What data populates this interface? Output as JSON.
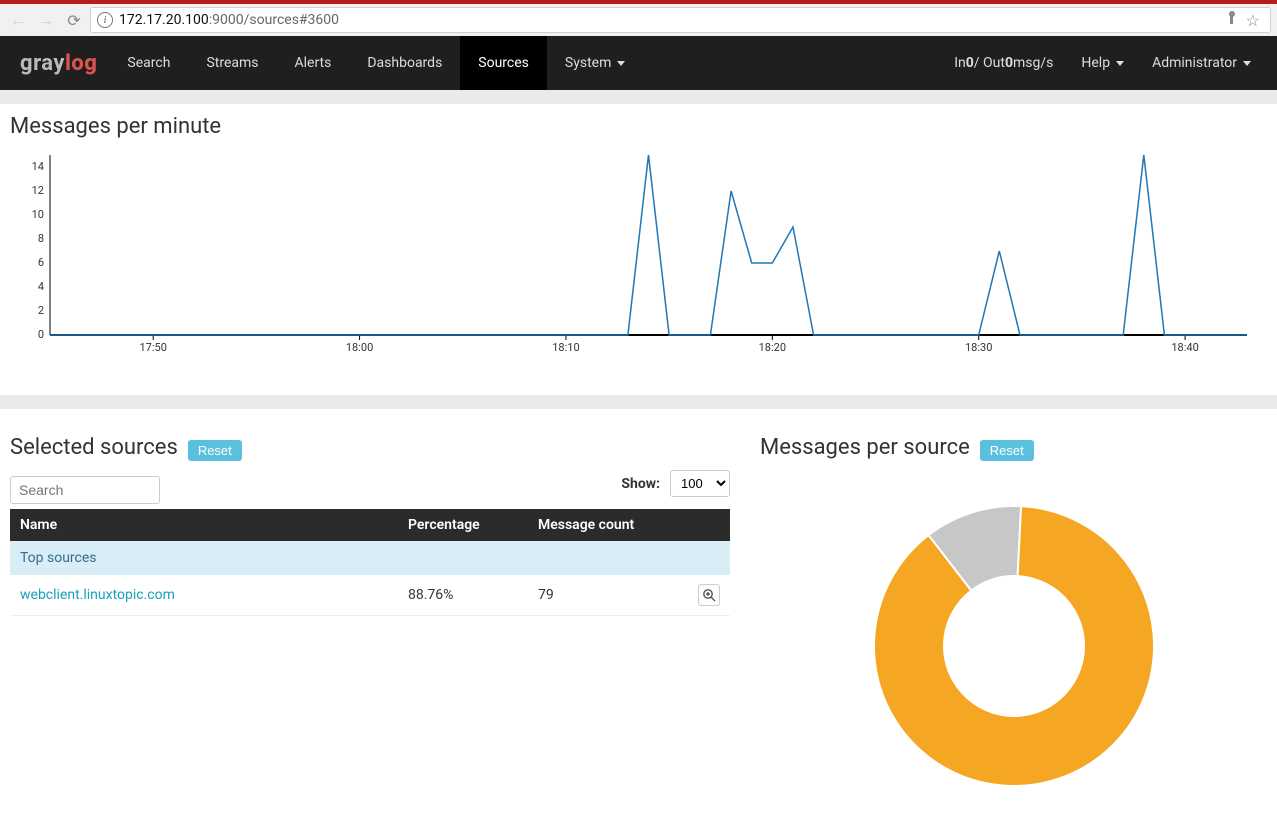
{
  "browser": {
    "url_host": "172.17.20.100",
    "url_rest": ":9000/sources#3600"
  },
  "nav": {
    "logo_a": "gray",
    "logo_b": "log",
    "items": [
      "Search",
      "Streams",
      "Alerts",
      "Dashboards",
      "Sources",
      "System"
    ],
    "active": "Sources",
    "io_text_pre": "In ",
    "io_in": "0",
    "io_mid": " / Out ",
    "io_out": "0",
    "io_suffix": " msg/s",
    "help": "Help",
    "admin": "Administrator"
  },
  "chart_top": {
    "title": "Messages per minute"
  },
  "selected": {
    "title": "Selected sources",
    "reset": "Reset",
    "search_placeholder": "Search",
    "show_label": "Show:",
    "show_value": "100",
    "cols": {
      "name": "Name",
      "pct": "Percentage",
      "count": "Message count"
    },
    "group_label": "Top sources",
    "rows": [
      {
        "name": "webclient.linuxtopic.com",
        "pct": "88.76%",
        "count": "79"
      }
    ]
  },
  "per_source": {
    "title": "Messages per source",
    "reset": "Reset"
  },
  "chart_data": [
    {
      "type": "line",
      "title": "Messages per minute",
      "xlabel": "",
      "ylabel": "",
      "ylim": [
        0,
        15
      ],
      "y_ticks": [
        0,
        2,
        4,
        6,
        8,
        10,
        12,
        14
      ],
      "x_ticks": [
        "17:50",
        "18:00",
        "18:10",
        "18:20",
        "18:30",
        "18:40"
      ],
      "x": [
        "17:45",
        "17:46",
        "17:47",
        "17:48",
        "17:49",
        "17:50",
        "17:51",
        "17:52",
        "17:53",
        "17:54",
        "17:55",
        "17:56",
        "17:57",
        "17:58",
        "17:59",
        "18:00",
        "18:01",
        "18:02",
        "18:03",
        "18:04",
        "18:05",
        "18:06",
        "18:07",
        "18:08",
        "18:09",
        "18:10",
        "18:11",
        "18:12",
        "18:13",
        "18:14",
        "18:15",
        "18:16",
        "18:17",
        "18:18",
        "18:19",
        "18:20",
        "18:21",
        "18:22",
        "18:23",
        "18:24",
        "18:25",
        "18:26",
        "18:27",
        "18:28",
        "18:29",
        "18:30",
        "18:31",
        "18:32",
        "18:33",
        "18:34",
        "18:35",
        "18:36",
        "18:37",
        "18:38",
        "18:39",
        "18:40",
        "18:41",
        "18:42",
        "18:43"
      ],
      "values": [
        0,
        0,
        0,
        0,
        0,
        0,
        0,
        0,
        0,
        0,
        0,
        0,
        0,
        0,
        0,
        0,
        0,
        0,
        0,
        0,
        0,
        0,
        0,
        0,
        0,
        0,
        0,
        0,
        0,
        15,
        0,
        0,
        0,
        12,
        6,
        6,
        9,
        0,
        0,
        0,
        0,
        0,
        0,
        0,
        0,
        0,
        7,
        0,
        0,
        0,
        0,
        0,
        0,
        15,
        0,
        0,
        0,
        0,
        0
      ]
    },
    {
      "type": "pie",
      "title": "Messages per source",
      "series": [
        {
          "name": "webclient.linuxtopic.com",
          "value": 88.76,
          "color": "#f5a623"
        },
        {
          "name": "other",
          "value": 11.24,
          "color": "#c7c7c7"
        }
      ]
    }
  ]
}
